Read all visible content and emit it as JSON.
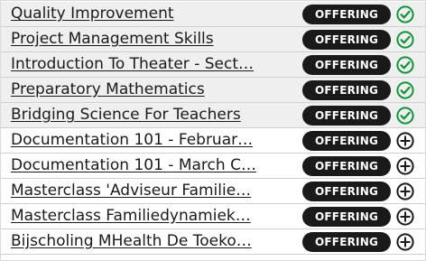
{
  "colors": {
    "check": "#12913a",
    "plus": "#1a1a1a",
    "badge_bg": "#1a1a1a"
  },
  "courses": [
    {
      "title": "Quality Improvement",
      "badge": "OFFERING",
      "status": "added",
      "icon": "check-circle-icon"
    },
    {
      "title": "Project Management Skills",
      "badge": "OFFERING",
      "status": "added",
      "icon": "check-circle-icon"
    },
    {
      "title": "Introduction To Theater - Sect…",
      "badge": "OFFERING",
      "status": "added",
      "icon": "check-circle-icon"
    },
    {
      "title": "Preparatory Mathematics",
      "badge": "OFFERING",
      "status": "added",
      "icon": "check-circle-icon"
    },
    {
      "title": "Bridging Science For Teachers",
      "badge": "OFFERING",
      "status": "added",
      "icon": "check-circle-icon"
    },
    {
      "title": "Documentation 101 - Februar…",
      "badge": "OFFERING",
      "status": "available",
      "icon": "plus-circle-icon"
    },
    {
      "title": "Documentation 101 - March C…",
      "badge": "OFFERING",
      "status": "available",
      "icon": "plus-circle-icon"
    },
    {
      "title": "Masterclass 'Adviseur Familie…",
      "badge": "OFFERING",
      "status": "available",
      "icon": "plus-circle-icon"
    },
    {
      "title": "Masterclass Familiedynamiek…",
      "badge": "OFFERING",
      "status": "available",
      "icon": "plus-circle-icon"
    },
    {
      "title": "Bijscholing MHealth De Toeko…",
      "badge": "OFFERING",
      "status": "available",
      "icon": "plus-circle-icon"
    }
  ]
}
